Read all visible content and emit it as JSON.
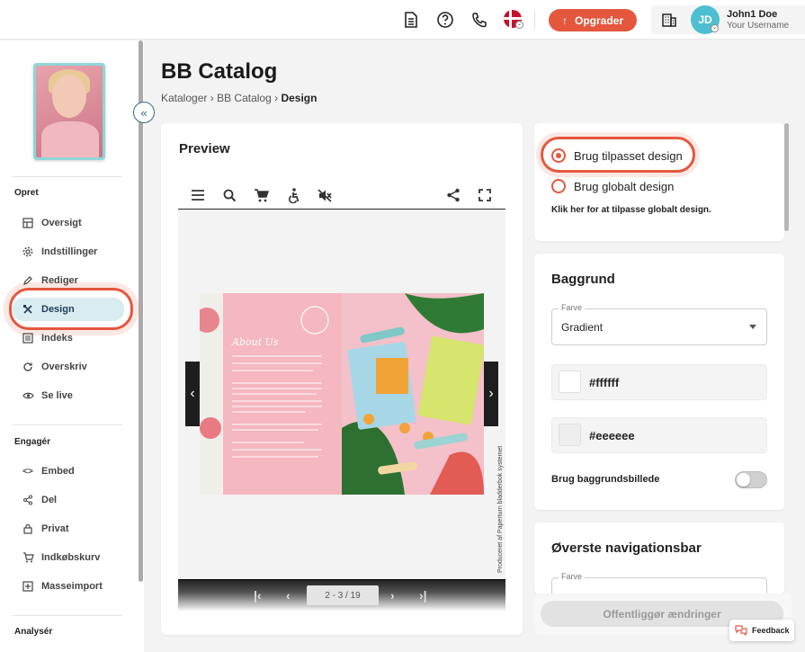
{
  "header": {
    "icons": [
      "document-icon",
      "help-icon",
      "phone-icon",
      "flag-dk-icon"
    ],
    "upgrade_label": "Opgrader",
    "user": {
      "initials": "JD",
      "name": "John1 Doe",
      "username": "Your Username"
    }
  },
  "sidebar": {
    "sections": [
      {
        "label": "Opret",
        "items": [
          {
            "label": "Oversigt",
            "icon": "layout-icon"
          },
          {
            "label": "Indstillinger",
            "icon": "gear-icon"
          },
          {
            "label": "Rediger",
            "icon": "pencil-icon"
          },
          {
            "label": "Design",
            "icon": "design-tools-icon",
            "active": true
          },
          {
            "label": "Indeks",
            "icon": "index-list-icon"
          },
          {
            "label": "Overskriv",
            "icon": "refresh-icon"
          },
          {
            "label": "Se live",
            "icon": "eye-icon"
          }
        ]
      },
      {
        "label": "Engagér",
        "items": [
          {
            "label": "Embed",
            "icon": "code-icon"
          },
          {
            "label": "Del",
            "icon": "share-icon"
          },
          {
            "label": "Privat",
            "icon": "lock-icon"
          },
          {
            "label": "Indkøbskurv",
            "icon": "cart-icon"
          },
          {
            "label": "Masseimport",
            "icon": "import-icon"
          }
        ]
      },
      {
        "label": "Analysér",
        "items": []
      }
    ]
  },
  "page": {
    "title": "BB Catalog",
    "breadcrumb": [
      "Kataloger",
      "BB Catalog",
      "Design"
    ]
  },
  "preview": {
    "title": "Preview",
    "toolbar_icons": [
      "menu-icon",
      "search-icon",
      "cart-icon",
      "accessibility-icon",
      "mute-icon",
      "share-icon",
      "fullscreen-icon"
    ],
    "book": {
      "left_heading": "About Us"
    },
    "credit": "Produceret af Paperturn bladderbok systemet",
    "pager": {
      "count": "2 - 3 / 19"
    }
  },
  "design_mode": {
    "options": [
      {
        "label": "Brug tilpasset design",
        "selected": true
      },
      {
        "label": "Brug globalt design",
        "selected": false
      }
    ],
    "hint": "Klik her for at tilpasse globalt design."
  },
  "background": {
    "title": "Baggrund",
    "color_label": "Farve",
    "color_value": "Gradient",
    "color_1": "#ffffff",
    "color_2": "#eeeeee",
    "bg_image_label": "Brug baggrundsbillede",
    "bg_image_enabled": false
  },
  "top_nav": {
    "title": "Øverste navigationsbar",
    "color_label": "Farve"
  },
  "publish_label": "Offentliggør ændringer",
  "feedback_label": "Feedback",
  "colors": {
    "accent": "#e4573d",
    "active_bg": "#d9ecef",
    "avatar": "#4dbfd0"
  }
}
